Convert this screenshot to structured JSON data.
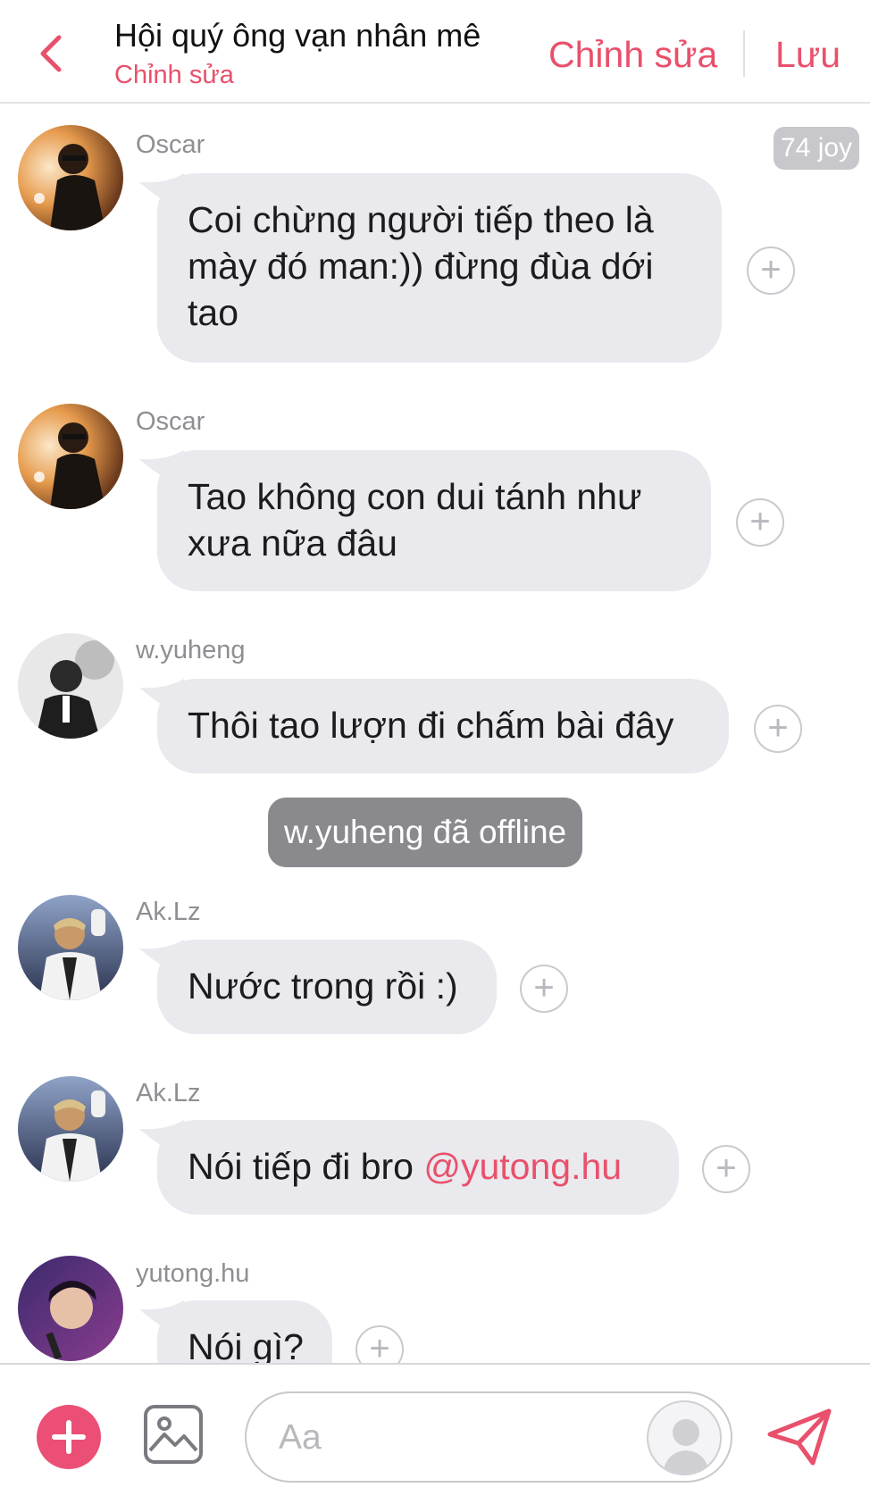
{
  "header": {
    "title": "Hội quý ông vạn nhân mê",
    "subtitle": "Chỉnh sửa",
    "edit_label": "Chỉnh sửa",
    "save_label": "Lưu"
  },
  "joy_badge": "74 joy",
  "messages": [
    {
      "sender": "Oscar",
      "text": "Coi chừng người tiếp theo là mày đó man:)) đừng đùa dới tao",
      "avatar": "oscar"
    },
    {
      "sender": "Oscar",
      "text": "Tao không con dui tánh như xưa nữa đâu",
      "avatar": "oscar"
    },
    {
      "sender": "w.yuheng",
      "text": "Thôi tao lượn đi chấm bài đây",
      "avatar": "yuheng"
    },
    {
      "sender": "Ak.Lz",
      "text": "Nước trong rồi :)",
      "avatar": "aklz"
    },
    {
      "sender": "Ak.Lz",
      "text": "Nói tiếp đi bro ",
      "mention": "@yutong.hu",
      "avatar": "aklz"
    },
    {
      "sender": "yutong.hu",
      "text": "Nói gì?",
      "avatar": "yutong"
    }
  ],
  "system_notice": "w.yuheng đã offline",
  "react_symbol": "+",
  "input": {
    "placeholder": "Aa",
    "value": ""
  },
  "icons": {
    "back": "chevron-left-icon",
    "add": "plus-icon",
    "image": "image-icon",
    "send": "paper-plane-icon",
    "profile": "user-silhouette-icon"
  },
  "colors": {
    "accent": "#e9506b",
    "plus_button": "#ec4f76",
    "bubble": "#e9e9ee",
    "system_pill": "#8a8a8e"
  }
}
